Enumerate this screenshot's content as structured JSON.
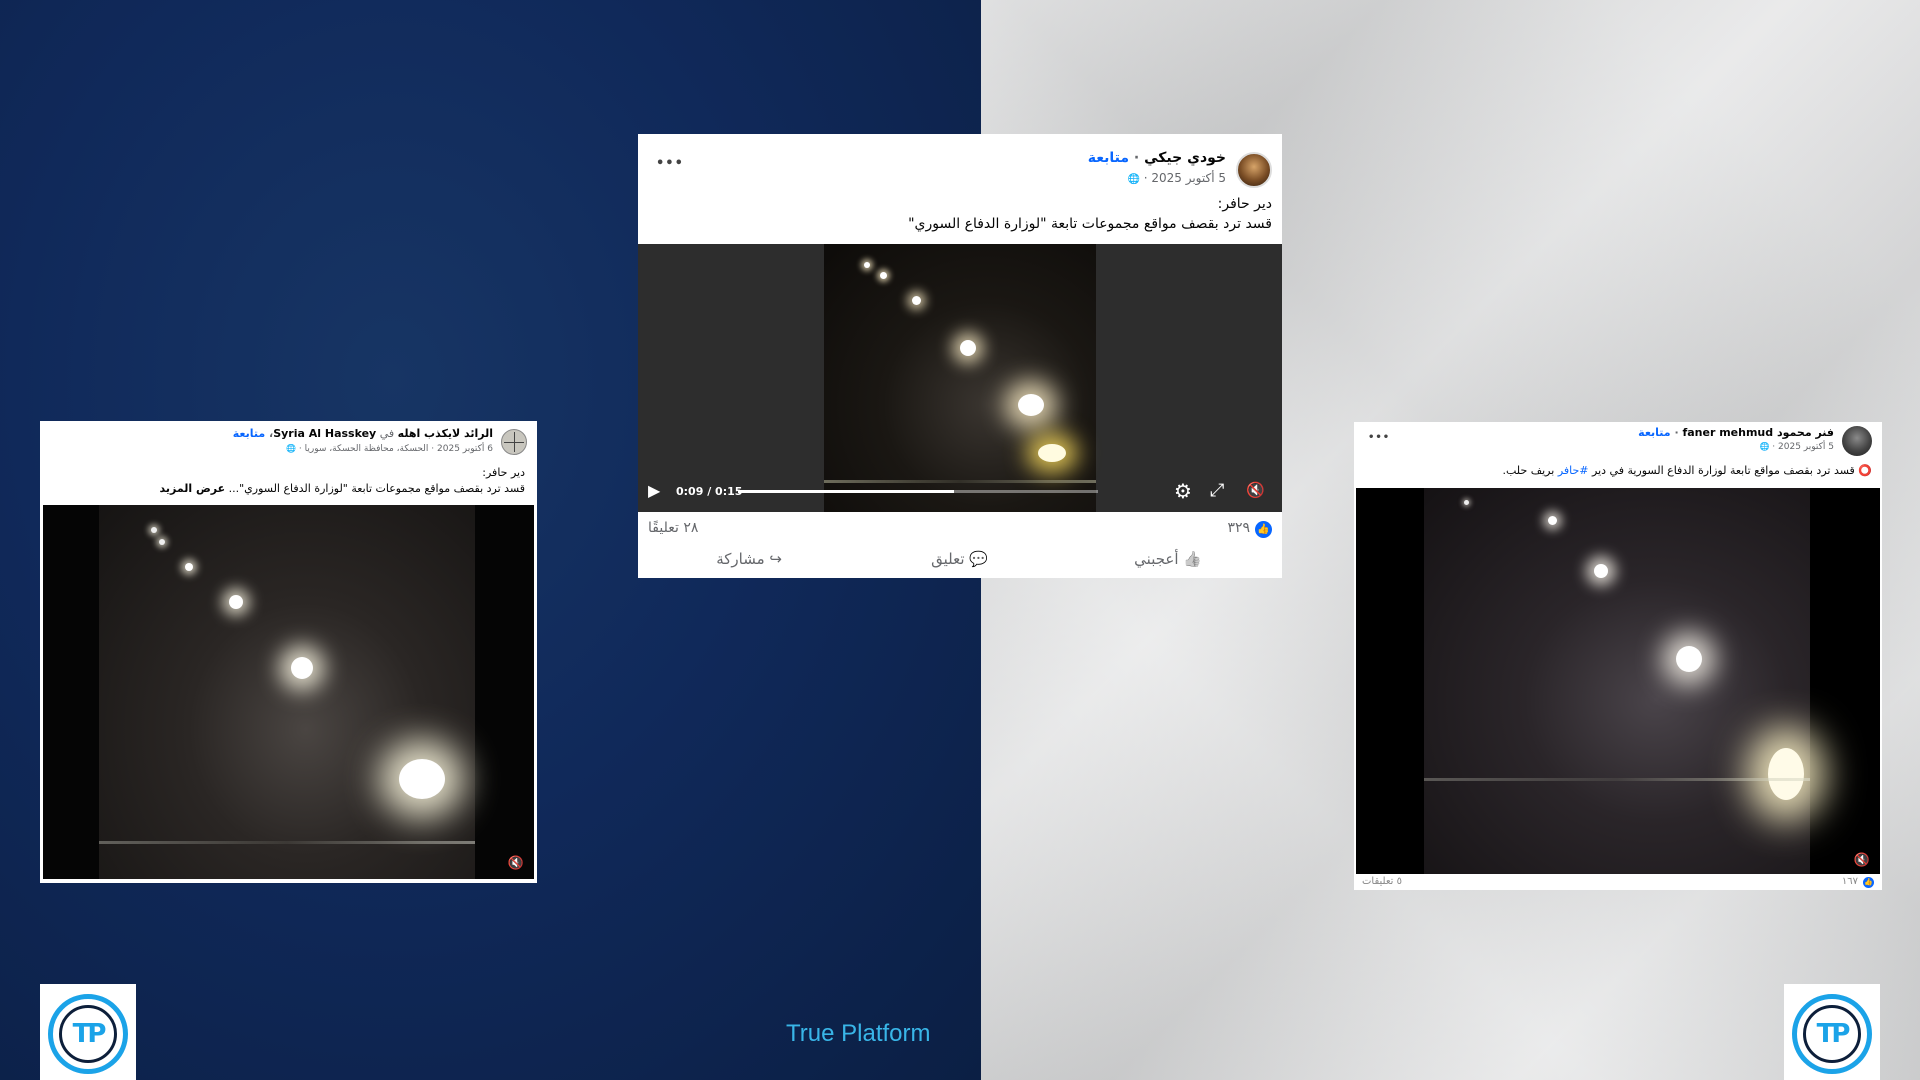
{
  "brand": {
    "label": "True Platform",
    "logo_left": "TP",
    "logo_right": "TP",
    "accent": "#1ba3e8"
  },
  "post_center": {
    "author": "خودي جيكي",
    "separator": " · ",
    "follow": "متابعة",
    "date": "5 أكتوبر 2025 · ",
    "globe": "🌐",
    "more": "•••",
    "line1": "دير حافر:",
    "line2": "قسد ترد بقصف  مواقع مجموعات تابعة \"لوزارة الدفاع السوري\"",
    "video": {
      "time": "0:09 / 0:15",
      "progress": 0.6
    },
    "reactions_count": "٣٢٩",
    "comments_count": "٢٨ تعليقًا",
    "like_label": "أعجبني",
    "comment_label": "تعليق",
    "share_label": "مشاركة"
  },
  "post_left": {
    "author": "الرائد لايكذب اهله",
    "in_word": " في ",
    "group": "Syria Al Hasskey",
    "separator": "، ",
    "follow": "متابعة",
    "date": "6 أكتوبر 2025 · الحسكة، محافظة الحسكة، سوريا · ",
    "globe": "🌐",
    "line1": "دير حافر:",
    "line2": "قسد ترد بقصف  مواقع مجموعات تابعة \"لوزارة الدفاع السوري\"... ",
    "see_more": "عرض المزيد"
  },
  "post_right": {
    "author": "فنر محمود faner mehmud",
    "separator": " · ",
    "follow": "متابعة",
    "date": "5 أكتوبر 2025 · ",
    "globe": "🌐",
    "more": "•••",
    "mark": "⭕",
    "text_a": " قسد ترد بقصف مواقع تابعة لوزارة الدفاع السورية في دير ",
    "hashtag": "#حافر",
    "text_b": " بريف حلب.",
    "reactions_count": "١٦٧",
    "comments_count": "٥ تعليقات"
  },
  "icons": {
    "play": "▶",
    "settings": "⚙",
    "fullscreen": "⤢",
    "mute": "🔇",
    "like": "👍",
    "comment": "💬",
    "share": "↪"
  },
  "colors": {
    "link_blue": "#0866ff",
    "navy_bg": "#10295a",
    "paper_bg": "#d9dadb"
  }
}
